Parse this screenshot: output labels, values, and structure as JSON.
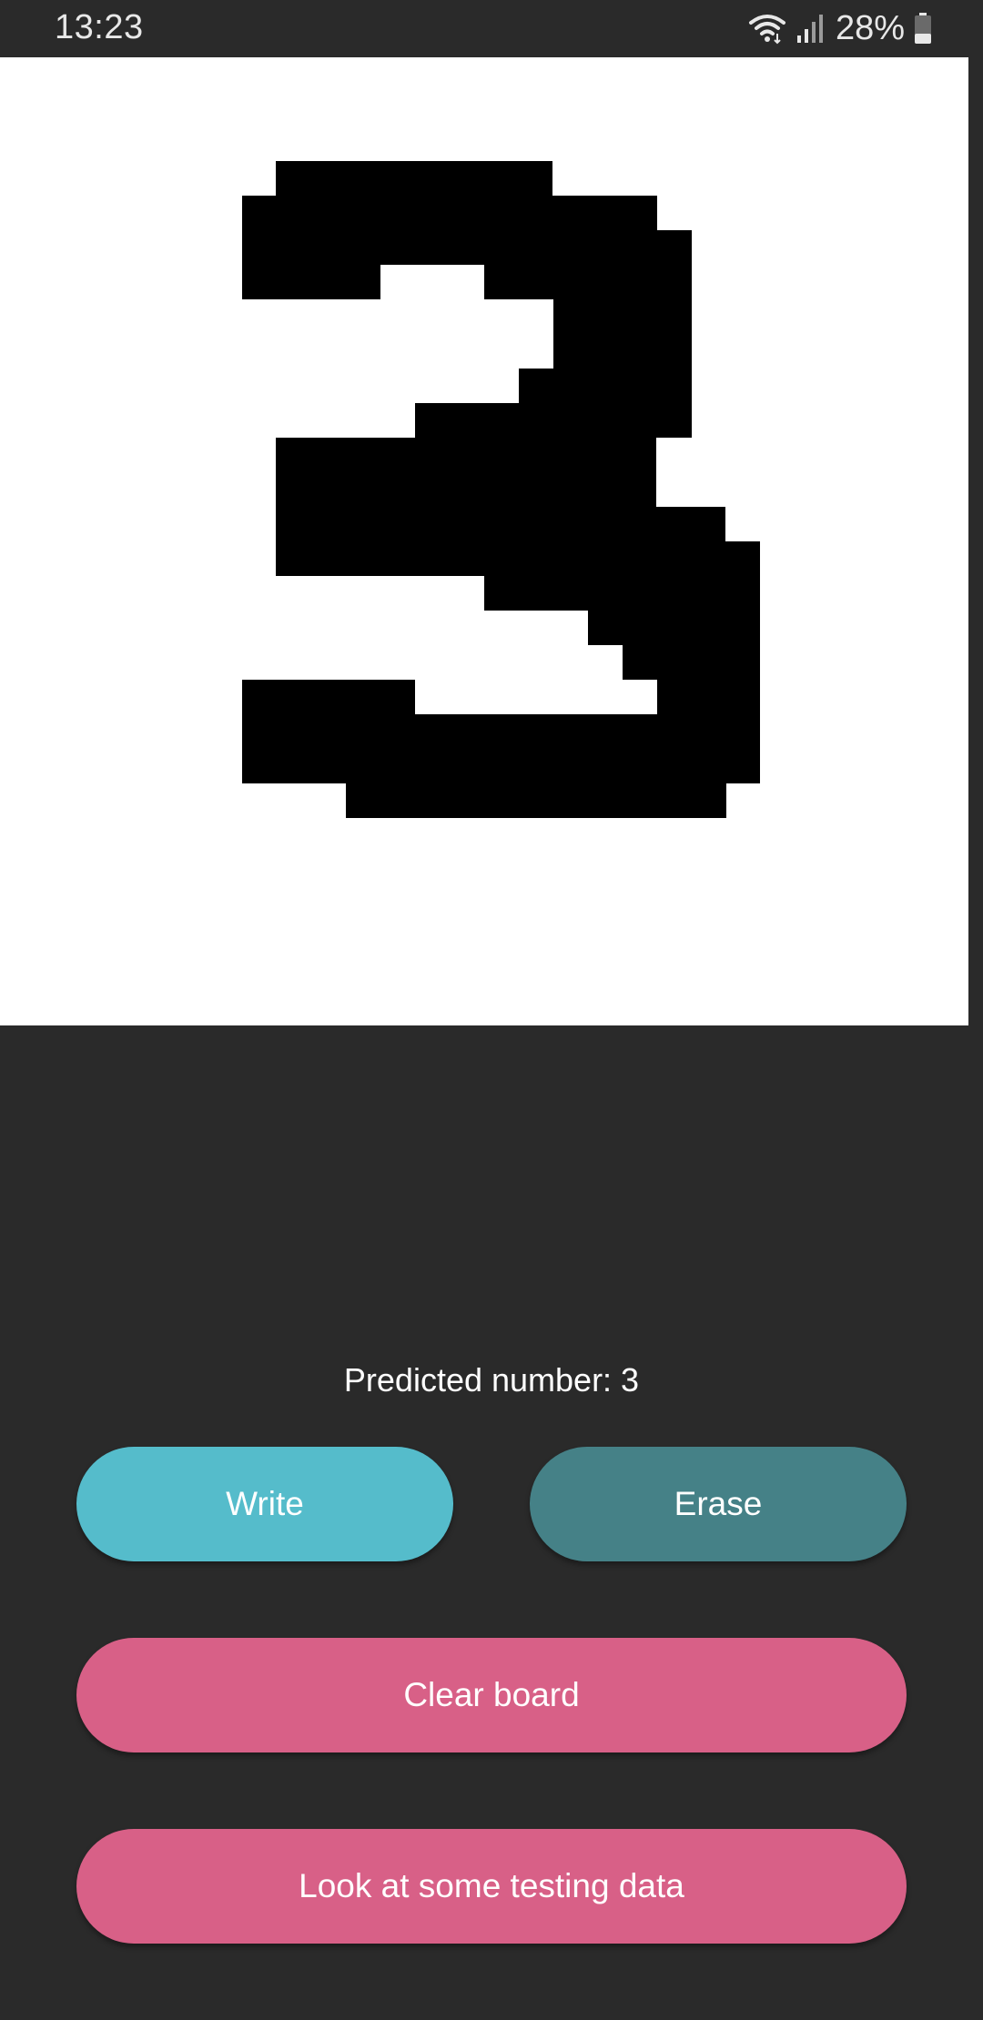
{
  "status_bar": {
    "time": "13:23",
    "battery_percent": "28%",
    "icons": [
      "wifi-icon",
      "signal-icon",
      "battery-icon"
    ]
  },
  "canvas": {
    "digit_drawn": "3"
  },
  "prediction": {
    "text": "Predicted number: 3"
  },
  "buttons": {
    "write_label": "Write",
    "erase_label": "Erase",
    "clear_label": "Clear board",
    "testing_label": "Look at some testing data"
  },
  "colors": {
    "background": "#2a2a2a",
    "canvas": "#ffffff",
    "ink": "#000000",
    "write": "#55bccb",
    "erase": "#458187",
    "accent_pink": "#d86087"
  }
}
